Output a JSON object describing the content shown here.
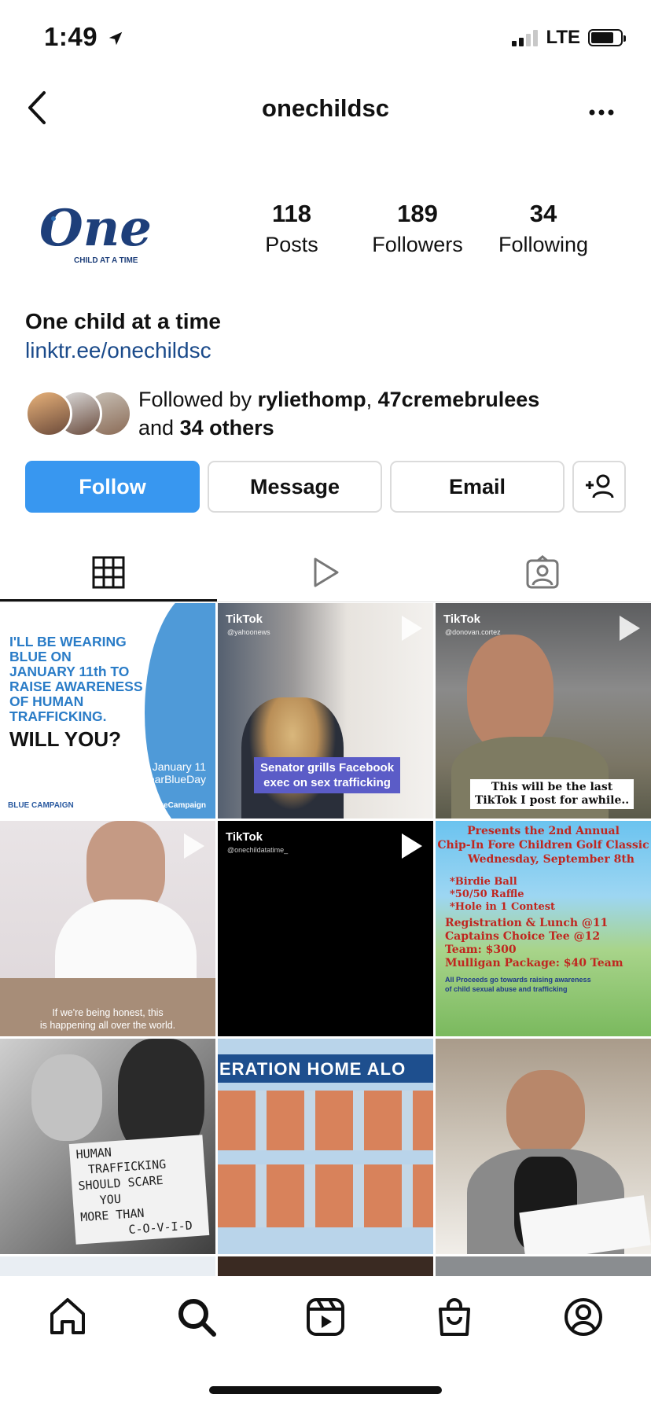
{
  "status_bar": {
    "time": "1:49",
    "network": "LTE"
  },
  "header": {
    "username": "onechildsc"
  },
  "profile": {
    "logo_text": "One",
    "logo_sub": "CHILD AT A TIME",
    "stats": [
      {
        "value": "118",
        "label": "Posts"
      },
      {
        "value": "189",
        "label": "Followers"
      },
      {
        "value": "34",
        "label": "Following"
      }
    ],
    "bio_name": "One child at a time",
    "bio_link": "linktr.ee/onechildsc",
    "followed_by_prefix": "Followed by ",
    "followed_by_user1": "ryliethomp",
    "followed_by_sep": ", ",
    "followed_by_user2": "47cremebrulees",
    "followed_by_and": "and ",
    "followed_by_others": "34 others"
  },
  "buttons": {
    "follow": "Follow",
    "message": "Message",
    "email": "Email"
  },
  "tabs": [
    {
      "name": "grid",
      "icon": "grid-icon"
    },
    {
      "name": "reels",
      "icon": "play-icon"
    },
    {
      "name": "tagged",
      "icon": "tagged-icon"
    }
  ],
  "posts": {
    "p1": {
      "line1": "I'LL BE WEARING",
      "line2": "BLUE ON",
      "line3": "JANUARY 11th TO",
      "line4": "RAISE AWARENESS",
      "line5": "OF HUMAN",
      "line6": "TRAFFICKING.",
      "line7": "WILL YOU?",
      "date": "January 11",
      "tag": "#WearBlueDay",
      "campaign": "BLUE CAMPAIGN",
      "handle": "@DHSBlueCampaign"
    },
    "p2": {
      "tiktok": "TikTok",
      "handle": "@yahoonews",
      "caption1": "Senator grills Facebook",
      "caption2": "exec on sex trafficking"
    },
    "p3": {
      "tiktok": "TikTok",
      "handle": "@donovan.cortez",
      "caption1": "This will be the last",
      "caption2": "TikTok I post for awhile.."
    },
    "p4": {
      "caption1": "If we're being honest, this",
      "caption2": "is happening all over the world."
    },
    "p5": {
      "tiktok": "TikTok",
      "handle": "@onechildatatime_"
    },
    "p6": {
      "line1": "Presents the 2nd Annual",
      "line2": "Chip-In Fore Children Golf Classic",
      "line3": "Wednesday, September 8th",
      "line4": "*Birdie Ball",
      "line5": "*50/50 Raffle",
      "line6": "*Hole in 1 Contest",
      "line7": "Registration & Lunch @11",
      "line8": "Captains Choice Tee @12",
      "line9": "Team: $300",
      "line10": "Mulligan Package: $40 Team",
      "line11": "All Proceeds go towards raising awareness",
      "line12": "of child sexual abuse and trafficking"
    },
    "p7": {
      "sign1": "HUMAN",
      "sign2": "TRAFFICKING",
      "sign3": "SHOULD SCARE",
      "sign4": "YOU",
      "sign5": "MORE  THAN",
      "sign6": "C-O-V-I-D"
    },
    "p8": {
      "banner": "ERATION HOME ALO"
    }
  },
  "nav": [
    "home-icon",
    "search-icon",
    "reels-icon",
    "shop-icon",
    "profile-icon"
  ]
}
